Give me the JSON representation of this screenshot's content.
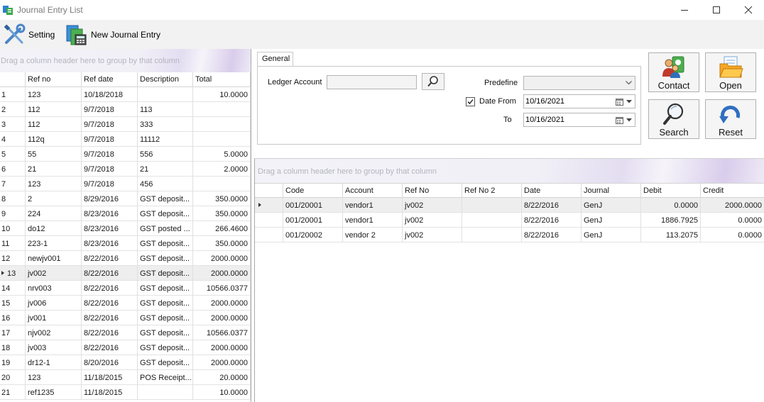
{
  "window": {
    "title": "Journal Entry List"
  },
  "toolbar": {
    "setting_label": "Setting",
    "new_entry_label": "New Journal Entry"
  },
  "left_grid": {
    "group_hint": "Drag a column header here to group by that column",
    "columns": [
      "Ref no",
      "Ref date",
      "Description",
      "Total"
    ],
    "rows": [
      {
        "idx": "1",
        "ref": "123",
        "date": "10/18/2018",
        "desc": "",
        "total": "10.0000"
      },
      {
        "idx": "2",
        "ref": "112",
        "date": "9/7/2018",
        "desc": "113",
        "total": ""
      },
      {
        "idx": "3",
        "ref": "112",
        "date": "9/7/2018",
        "desc": "333",
        "total": ""
      },
      {
        "idx": "4",
        "ref": "112q",
        "date": "9/7/2018",
        "desc": "11112",
        "total": ""
      },
      {
        "idx": "5",
        "ref": "55",
        "date": "9/7/2018",
        "desc": "556",
        "total": "5.0000"
      },
      {
        "idx": "6",
        "ref": "21",
        "date": "9/7/2018",
        "desc": "21",
        "total": "2.0000"
      },
      {
        "idx": "7",
        "ref": "123",
        "date": "9/7/2018",
        "desc": "456",
        "total": ""
      },
      {
        "idx": "8",
        "ref": "2",
        "date": "8/29/2016",
        "desc": "GST deposit...",
        "total": "350.0000"
      },
      {
        "idx": "9",
        "ref": "224",
        "date": "8/23/2016",
        "desc": "GST deposit...",
        "total": "350.0000"
      },
      {
        "idx": "10",
        "ref": "do12",
        "date": "8/23/2016",
        "desc": "GST posted ...",
        "total": "266.4600"
      },
      {
        "idx": "11",
        "ref": "223-1",
        "date": "8/23/2016",
        "desc": "GST deposit...",
        "total": "350.0000"
      },
      {
        "idx": "12",
        "ref": "newjv001",
        "date": "8/22/2016",
        "desc": "GST deposit...",
        "total": "2000.0000"
      },
      {
        "idx": "13",
        "ref": "jv002",
        "date": "8/22/2016",
        "desc": "GST deposit...",
        "total": "2000.0000",
        "selected": true
      },
      {
        "idx": "14",
        "ref": "nrv003",
        "date": "8/22/2016",
        "desc": "GST deposit...",
        "total": "10566.0377"
      },
      {
        "idx": "15",
        "ref": "jv006",
        "date": "8/22/2016",
        "desc": "GST deposit...",
        "total": "2000.0000"
      },
      {
        "idx": "16",
        "ref": "jv001",
        "date": "8/22/2016",
        "desc": "GST deposit...",
        "total": "2000.0000"
      },
      {
        "idx": "17",
        "ref": "njv002",
        "date": "8/22/2016",
        "desc": "GST deposit...",
        "total": "10566.0377"
      },
      {
        "idx": "18",
        "ref": "jv003",
        "date": "8/22/2016",
        "desc": "GST deposit...",
        "total": "2000.0000"
      },
      {
        "idx": "19",
        "ref": "dr12-1",
        "date": "8/20/2016",
        "desc": "GST deposit...",
        "total": "2000.0000"
      },
      {
        "idx": "20",
        "ref": "123",
        "date": "11/18/2015",
        "desc": "POS Receipt...",
        "total": "20.0000"
      },
      {
        "idx": "21",
        "ref": "ref1235",
        "date": "11/18/2015",
        "desc": "",
        "total": "10.0000"
      }
    ]
  },
  "filter": {
    "tab_label": "General",
    "ledger_label": "Ledger Account",
    "ledger_value": "",
    "predefine_label": "Predefine",
    "predefine_value": "",
    "date_from_label": "Date From",
    "date_from_checked": true,
    "date_from_value": "10/16/2021",
    "to_label": "To",
    "to_value": "10/16/2021"
  },
  "actions": {
    "contact": "Contact",
    "open": "Open",
    "search": "Search",
    "reset": "Reset"
  },
  "detail_grid": {
    "group_hint": "Drag a column header here to group by that column",
    "columns": [
      "Code",
      "Account",
      "Ref No",
      "Ref No 2",
      "Date",
      "Journal",
      "Debit",
      "Credit"
    ],
    "rows": [
      {
        "code": "001/20001",
        "account": "vendor1",
        "ref": "jv002",
        "ref2": "",
        "date": "8/22/2016",
        "journal": "GenJ",
        "debit": "0.0000",
        "credit": "2000.0000",
        "selected": true
      },
      {
        "code": "001/20001",
        "account": "vendor1",
        "ref": "jv002",
        "ref2": "",
        "date": "8/22/2016",
        "journal": "GenJ",
        "debit": "1886.7925",
        "credit": "0.0000"
      },
      {
        "code": "001/20002",
        "account": "vendor 2",
        "ref": "jv002",
        "ref2": "",
        "date": "8/22/2016",
        "journal": "GenJ",
        "debit": "113.2075",
        "credit": "0.0000"
      }
    ]
  },
  "icons": {
    "app": "journal-app-icon",
    "setting": "tools-icon",
    "new_entry": "new-journal-icon",
    "lookup": "magnifier-icon",
    "contact": "contact-icon",
    "open": "folder-open-icon",
    "search": "search-icon",
    "reset": "reset-arrow-icon"
  }
}
